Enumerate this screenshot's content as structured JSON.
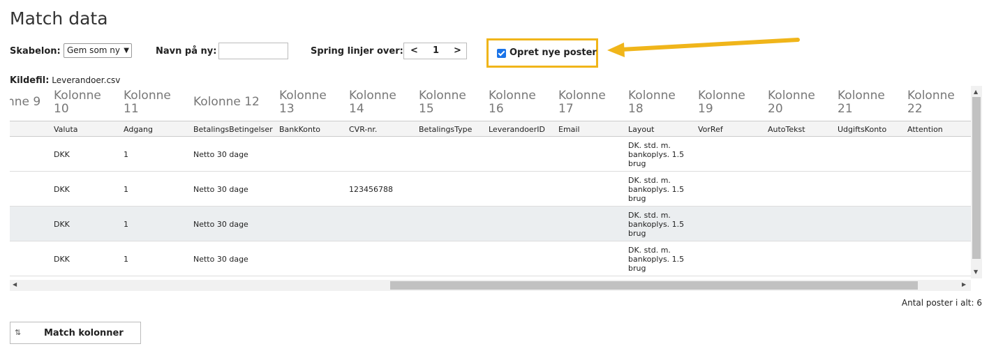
{
  "page": {
    "title": "Match data"
  },
  "controls": {
    "template_label": "Skabelon:",
    "template_value": "Gem som ny",
    "name_label": "Navn på ny:",
    "name_value": "",
    "skip_label": "Spring linjer over:",
    "skip_value": "1",
    "prev": "<",
    "next": ">",
    "create_new_label": "Opret nye poster",
    "create_new_checked": true
  },
  "source": {
    "label": "Kildefil:",
    "file": "Leverandoer.csv"
  },
  "table": {
    "columns": [
      {
        "header": "nne 9",
        "field": ""
      },
      {
        "header": "Kolonne 10",
        "field": "Valuta"
      },
      {
        "header": "Kolonne 11",
        "field": "Adgang"
      },
      {
        "header": "Kolonne 12",
        "field": "BetalingsBetingelser"
      },
      {
        "header": "Kolonne 13",
        "field": "BankKonto"
      },
      {
        "header": "Kolonne 14",
        "field": "CVR-nr."
      },
      {
        "header": "Kolonne 15",
        "field": "BetalingsType"
      },
      {
        "header": "Kolonne 16",
        "field": "LeverandoerID"
      },
      {
        "header": "Kolonne 17",
        "field": "Email"
      },
      {
        "header": "Kolonne 18",
        "field": "Layout"
      },
      {
        "header": "Kolonne 19",
        "field": "VorRef"
      },
      {
        "header": "Kolonne 20",
        "field": "AutoTekst"
      },
      {
        "header": "Kolonne 21",
        "field": "UdgiftsKonto"
      },
      {
        "header": "Kolonne 22",
        "field": "Attention"
      }
    ],
    "rows": [
      {
        "valuta": "DKK",
        "adgang": "1",
        "betingelser": "Netto 30 dage",
        "cvr": "",
        "layout": "DK. std. m. bankoplys. 1.5 brug"
      },
      {
        "valuta": "DKK",
        "adgang": "1",
        "betingelser": "Netto 30 dage",
        "cvr": "123456788",
        "layout": "DK. std. m. bankoplys. 1.5 brug"
      },
      {
        "valuta": "DKK",
        "adgang": "1",
        "betingelser": "Netto 30 dage",
        "cvr": "",
        "layout": "DK. std. m. bankoplys. 1.5 brug"
      },
      {
        "valuta": "DKK",
        "adgang": "1",
        "betingelser": "Netto 30 dage",
        "cvr": "",
        "layout": "DK. std. m. bankoplys. 1.5 brug"
      }
    ]
  },
  "footer": {
    "count_text": "Antal poster i alt: 6",
    "match_button": "Match kolonner"
  },
  "colors": {
    "highlight": "#f0b51a",
    "checkbox": "#1a73e8"
  }
}
